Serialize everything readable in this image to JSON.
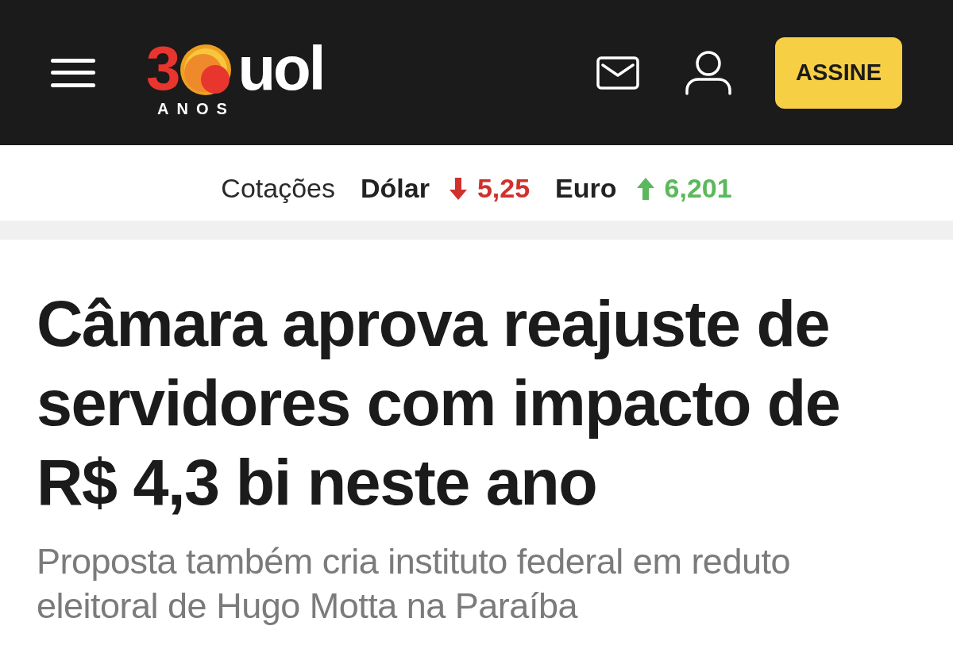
{
  "header": {
    "logo": {
      "number": "3",
      "brand": "uol",
      "caption": "ANOS"
    },
    "subscribe_button": "ASSINE"
  },
  "quotes": {
    "label": "Cotações",
    "items": [
      {
        "name": "Dólar",
        "kind": "down",
        "value": "5,25",
        "color": "#d0312d"
      },
      {
        "name": "Euro",
        "kind": "up",
        "value": "6,201",
        "color": "#5cb85c"
      }
    ]
  },
  "article": {
    "headline": "Câmara aprova reajuste de servidores com impacto de R$ 4,3 bi neste ano",
    "subtitle": "Proposta também cria instituto federal em reduto eleitoral de Hugo Motta na Paraíba"
  }
}
